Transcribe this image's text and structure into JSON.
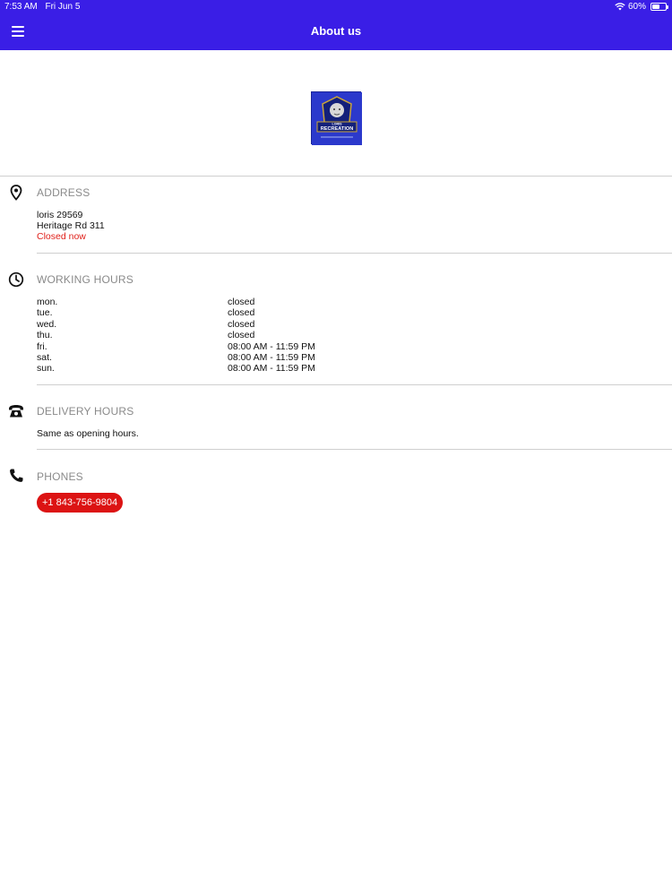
{
  "status_bar": {
    "time": "7:53 AM",
    "date": "Fri Jun 5",
    "battery": "60%",
    "battery_level": 0.6
  },
  "header": {
    "title": "About us",
    "menu_icon": "hamburger-menu-icon"
  },
  "logo": {
    "text_line1": "LORIS",
    "text_line2": "RECREATION"
  },
  "address": {
    "title": "ADDRESS",
    "icon": "location-pin-icon",
    "line1": "loris 29569",
    "line2": "Heritage Rd 311",
    "status": "Closed now",
    "status_color": "#e0201a"
  },
  "working_hours": {
    "title": "WORKING HOURS",
    "icon": "clock-icon",
    "rows": [
      {
        "day": "mon.",
        "time": "closed"
      },
      {
        "day": "tue.",
        "time": "closed"
      },
      {
        "day": "wed.",
        "time": "closed"
      },
      {
        "day": "thu.",
        "time": "closed"
      },
      {
        "day": "fri.",
        "time": "08:00 AM - 11:59 PM"
      },
      {
        "day": "sat.",
        "time": "08:00 AM - 11:59 PM"
      },
      {
        "day": "sun.",
        "time": "08:00 AM - 11:59 PM"
      }
    ]
  },
  "delivery_hours": {
    "title": "DELIVERY HOURS",
    "icon": "telephone-icon",
    "text": "Same as opening hours."
  },
  "phones": {
    "title": "PHONES",
    "icon": "phone-handset-icon",
    "numbers": [
      "+1 843-756-9804"
    ],
    "chip_color": "#dc1313"
  },
  "colors": {
    "header_bg": "#3a1ee6",
    "accent_red": "#dc1313"
  }
}
